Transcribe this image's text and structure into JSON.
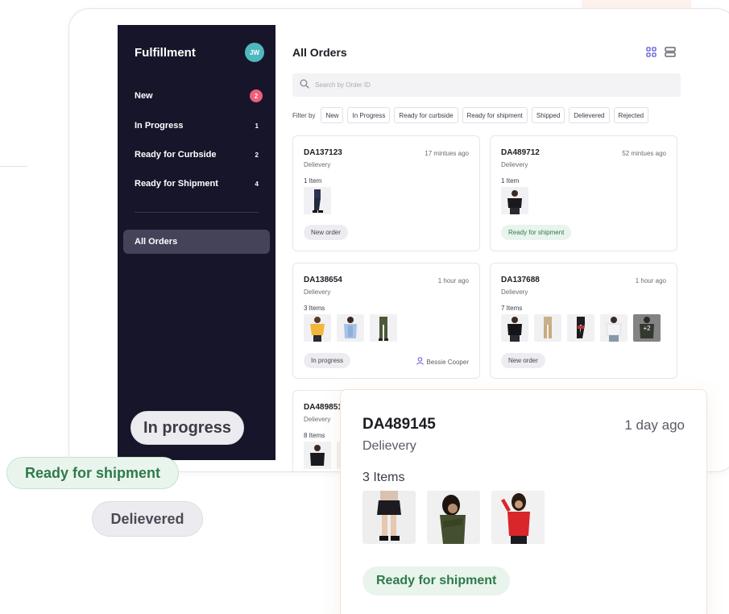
{
  "sidebar": {
    "title": "Fulfillment",
    "avatar_initials": "JW",
    "items": [
      {
        "label": "New",
        "count": "2"
      },
      {
        "label": "In Progress",
        "count": "1"
      },
      {
        "label": "Ready for Curbside",
        "count": "2"
      },
      {
        "label": "Ready for Shipment",
        "count": "4"
      }
    ],
    "active_item": "All Orders"
  },
  "main": {
    "title": "All Orders",
    "search_placeholder": "Search by Order ID",
    "filter_label": "Filter by",
    "filters": [
      "New",
      "In Progress",
      "Ready for curbside",
      "Ready for shipment",
      "Shipped",
      "Delievered",
      "Rejected"
    ]
  },
  "orders": [
    {
      "id": "DA137123",
      "time": "17 mintues ago",
      "type": "Delievery",
      "items": "1 Item",
      "status": "New order"
    },
    {
      "id": "DA489712",
      "time": "52 mintues ago",
      "type": "Delievery",
      "items": "1 Item",
      "status": "Ready for shipment"
    },
    {
      "id": "DA138654",
      "time": "1 hour ago",
      "type": "Delievery",
      "items": "3 Items",
      "status": "In progress",
      "assignee": "Bessie Cooper"
    },
    {
      "id": "DA137688",
      "time": "1 hour ago",
      "type": "Delievery",
      "items": "7 Items",
      "status": "New order",
      "more": "+2"
    },
    {
      "id": "DA489851",
      "type": "Delievery",
      "items": "8 Items"
    }
  ],
  "overlay": {
    "pill_in_progress": "In progress",
    "pill_ready_shipment": "Ready for shipment",
    "pill_delivered": "Delievered",
    "card": {
      "id": "DA489145",
      "time": "1 day ago",
      "type": "Delievery",
      "items": "3 Items",
      "status": "Ready for shipment"
    }
  },
  "colors": {
    "sidebar_bg": "#17152a",
    "accent_teal": "#4fb8bf",
    "badge_pink": "#ef5f7a",
    "status_green": "#2f7a4b",
    "status_green_bg": "#e8f4ec",
    "view_icon_purple": "#5b57d9"
  }
}
